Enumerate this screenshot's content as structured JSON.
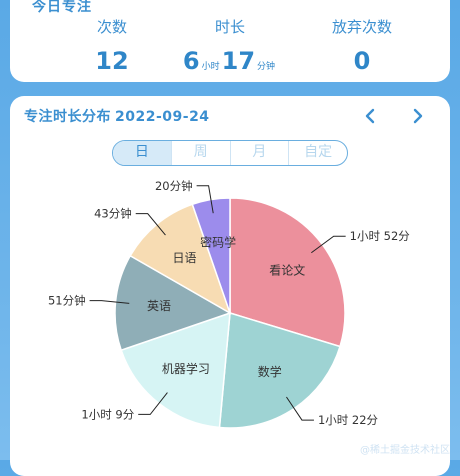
{
  "summary": {
    "title": "今日专注",
    "stats": [
      {
        "label": "次数",
        "value": "12"
      },
      {
        "label": "时长",
        "hours": "6",
        "hours_unit": "小时",
        "minutes": "17",
        "minutes_unit": "分钟"
      },
      {
        "label": "放弃次数",
        "value": "0"
      }
    ]
  },
  "distribution": {
    "title": "专注时长分布",
    "date": "2022-09-24",
    "tabs": [
      {
        "label": "日",
        "active": true
      },
      {
        "label": "周",
        "active": false
      },
      {
        "label": "月",
        "active": false
      },
      {
        "label": "自定",
        "active": false
      }
    ]
  },
  "chart_data": {
    "type": "pie",
    "slices": [
      {
        "name": "看论文",
        "minutes": 112,
        "value_label": "1小时 52分",
        "color": "#ec909c"
      },
      {
        "name": "数学",
        "minutes": 82,
        "value_label": "1小时 22分",
        "color": "#9ed3d3"
      },
      {
        "name": "机器学习",
        "minutes": 69,
        "value_label": "1小时 9分",
        "color": "#d6f4f4"
      },
      {
        "name": "英语",
        "minutes": 51,
        "value_label": "51分钟",
        "color": "#8faeb7"
      },
      {
        "name": "日语",
        "minutes": 43,
        "value_label": "43分钟",
        "color": "#f7dcb3"
      },
      {
        "name": "密码学",
        "minutes": 20,
        "value_label": "20分钟",
        "color": "#9c8cec"
      }
    ]
  },
  "watermark": "@稀土掘金技术社区"
}
